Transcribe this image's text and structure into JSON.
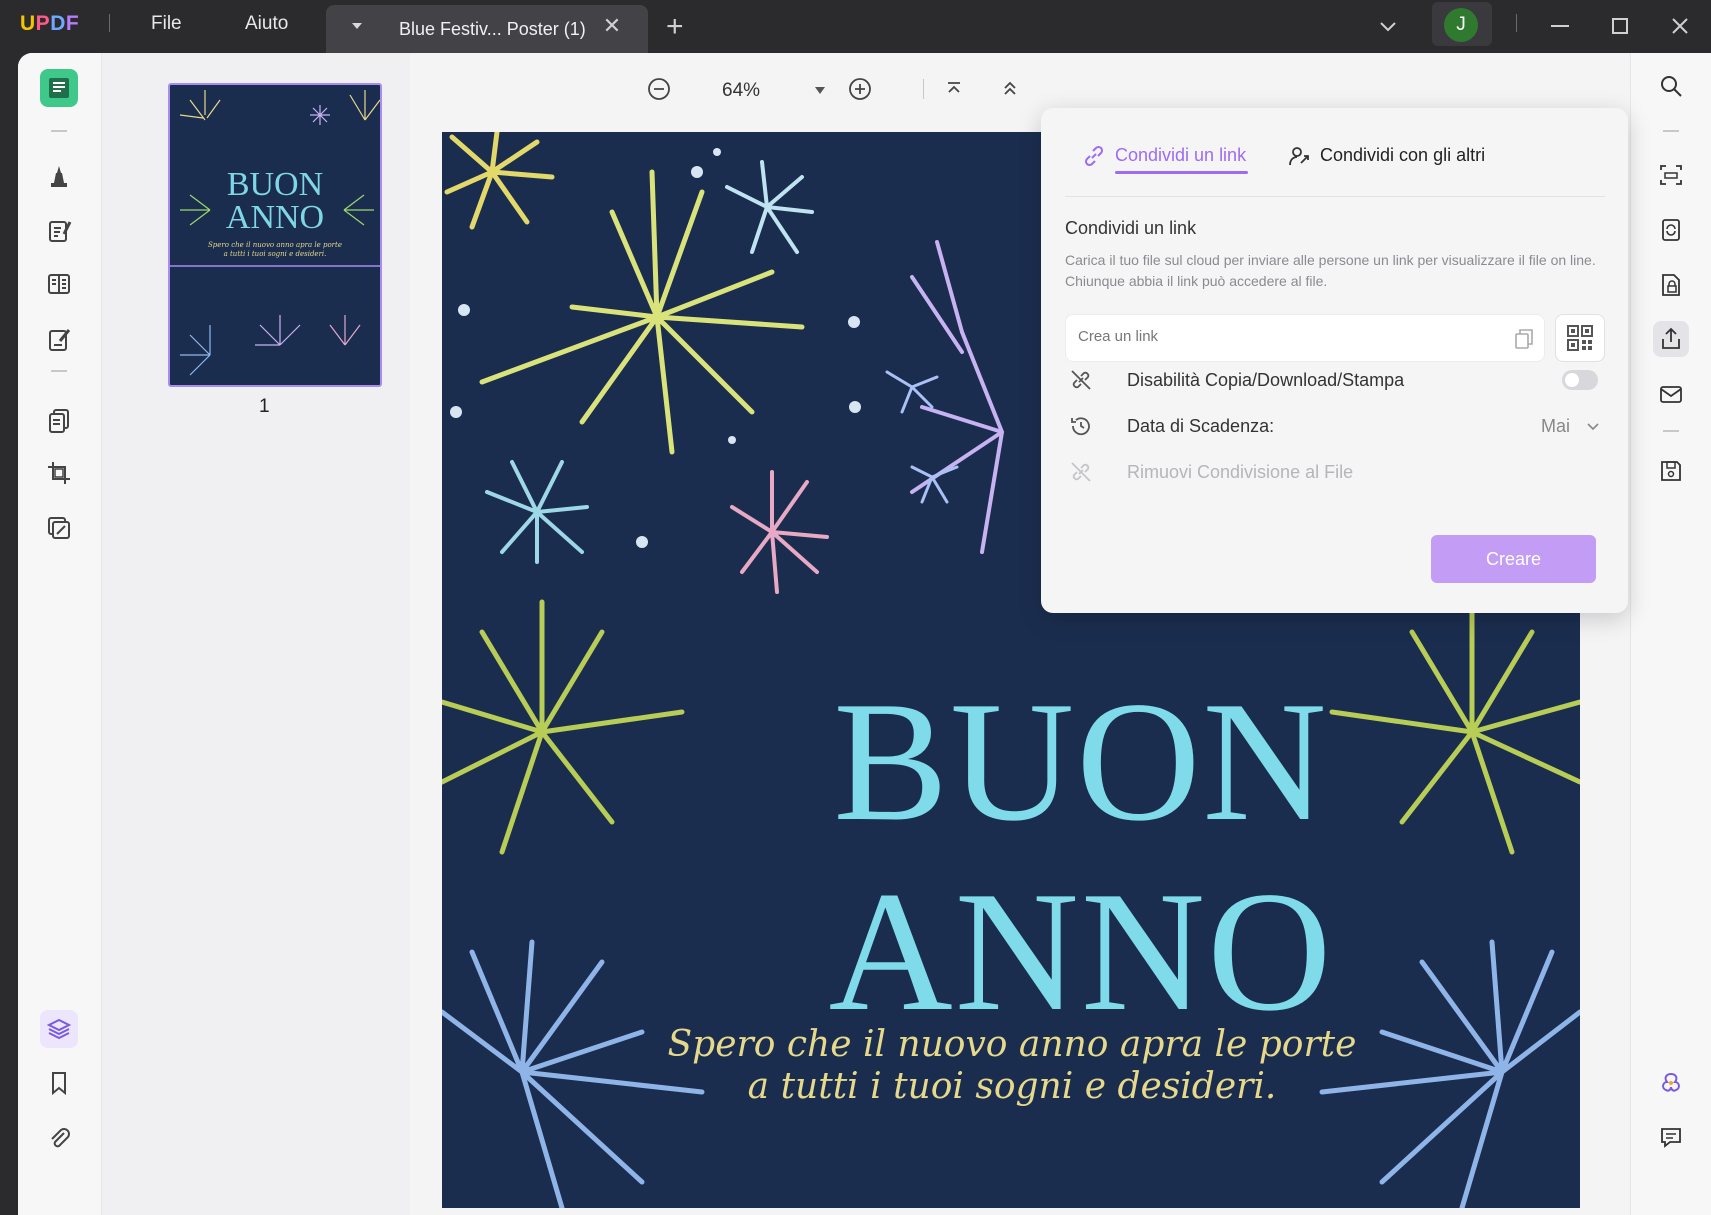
{
  "app": {
    "logo": [
      "U",
      "P",
      "D",
      "F"
    ],
    "menu": {
      "file": "File",
      "help": "Aiuto"
    },
    "tab_title": "Blue Festiv... Poster (1)",
    "tab_close": "✕",
    "new_tab": "+",
    "avatar_initial": "J"
  },
  "toolbar": {
    "zoom": "64%"
  },
  "thumbnails": {
    "page_number": "1",
    "title_line1": "BUON",
    "title_line2": "ANNO",
    "subtitle_line1": "Spero che il nuovo anno apra le porte",
    "subtitle_line2": "a tutti i tuoi sogni e desideri."
  },
  "document": {
    "title_line1": "BUON",
    "title_line2": "ANNO",
    "subtitle_line1": "Spero che il nuovo anno apra le porte",
    "subtitle_line2": "a tutti i tuoi sogni e desideri.",
    "colors": {
      "background": "#1b2d4f",
      "title": "#7fdbe9",
      "subtitle": "#e6d98a"
    }
  },
  "share_panel": {
    "tab_link": "Condividi un link",
    "tab_others": "Condividi con gli altri",
    "heading": "Condividi un link",
    "description": "Carica il tuo file sul cloud per inviare alle persone un link per visualizzare il file on line. Chiunque abbia il link può accedere al file.",
    "link_placeholder": "Crea un link",
    "option_disable": "Disabilità Copia/Download/Stampa",
    "disable_enabled": false,
    "option_expiry": "Data di Scadenza:",
    "expiry_value": "Mai",
    "option_remove": "Rimuovi Condivisione al File",
    "create_button": "Creare",
    "accent_color": "#9d6cf3"
  }
}
